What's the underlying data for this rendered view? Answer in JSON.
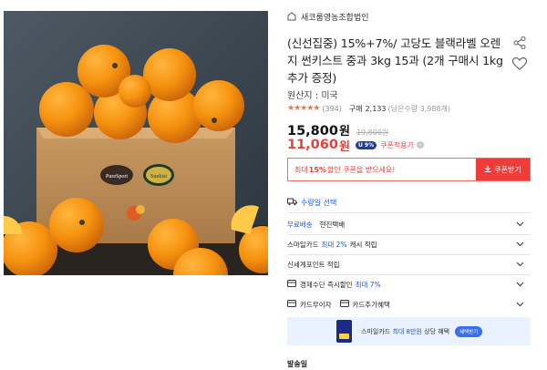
{
  "product": {
    "image_alt": "orange-box-photo",
    "box_labels": [
      "PureSport",
      "Sunkist"
    ]
  },
  "seller": {
    "name": "새코룸영농조합법인",
    "icon": "store-icon"
  },
  "title": "(신선집중) 15%+7%/ 고당도 블랙라벨 오렌지 썬키스트 중과 3kg 15과 (2개 구매시 1kg 추가 증정)",
  "origin": "원산지 : 미국",
  "rating": {
    "stars": "★★★★★",
    "score": 4.5,
    "reviews": "(394)",
    "buy_label": "구매",
    "buy_count": "2,133",
    "buy_note": "(남은수량 3,988개)"
  },
  "price": {
    "value": "15,800",
    "unit": "원",
    "original": "19,800원"
  },
  "coupon_price": {
    "value": "11,060",
    "unit": "원",
    "badge": "U 9%",
    "applied": "쿠폰적용가",
    "info": "i"
  },
  "coupon_box": {
    "msg_prefix": "최대",
    "msg_percent": "15%",
    "msg_suffix": "할인 쿠폰을 받으세요!",
    "button": "쿠폰받기"
  },
  "quantity_link": "수량일 선택",
  "rows": [
    {
      "label_blue": "무료배송",
      "label": "현진택배"
    },
    {
      "label": "스마일카드",
      "label_blue": "최대 2%",
      "label_after": "캐시 적립"
    },
    {
      "label": "신세계포인트 적립"
    },
    {
      "label": "경제수단 즉시할인",
      "label_blue": "최대 7%"
    },
    {
      "label": "카드무이자",
      "label2": "카드추가혜택"
    }
  ],
  "banner": {
    "text": "스마일카드",
    "blue": "최대 8만원",
    "text_after": "상당 혜택",
    "button": "혜택받기"
  },
  "ship_date": "발송일",
  "colors": {
    "accent_red": "#f03c38",
    "accent_blue": "#1f5bd6",
    "star": "#ff7043"
  }
}
